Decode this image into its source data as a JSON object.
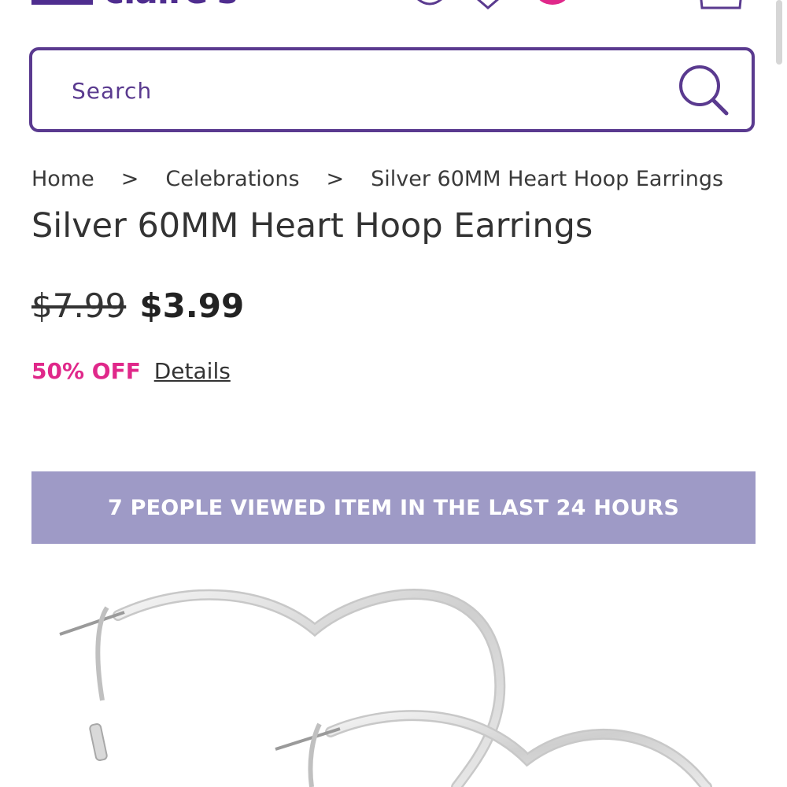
{
  "header": {
    "logo_text": "claire's",
    "icons": [
      "account-shield-icon",
      "location-pin-icon",
      "notification-dot-icon",
      "shopping-bag-icon"
    ],
    "accent_color": "#4f2d8f",
    "badge_color": "#e0288a"
  },
  "search": {
    "placeholder": "Search",
    "border_color": "#5a3a8f",
    "icon": "search-icon"
  },
  "breadcrumb": {
    "items": [
      "Home",
      "Celebrations",
      "Silver 60MM Heart Hoop Earrings"
    ],
    "separator": ">"
  },
  "product": {
    "title": "Silver 60MM Heart Hoop Earrings",
    "original_price": "$7.99",
    "sale_price": "$3.99",
    "discount_label": "50% OFF",
    "details_link": "Details",
    "discount_color": "#e0288a"
  },
  "banner": {
    "text": "7 PEOPLE VIEWED ITEM IN THE LAST 24 HOURS",
    "background_color": "#9e9ac6"
  },
  "image": {
    "subject": "silver-heart-hoop-earrings-photo"
  }
}
